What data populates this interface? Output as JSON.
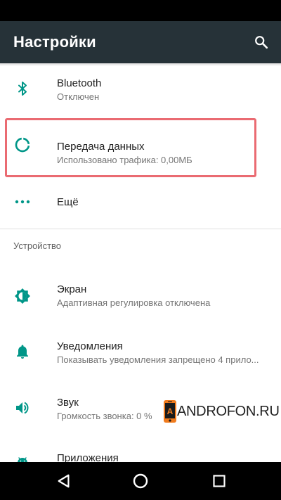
{
  "header": {
    "title": "Настройки"
  },
  "icons": {
    "search": "search-icon",
    "bluetooth": "bluetooth-icon",
    "data_usage": "data-usage-icon",
    "more": "more-horiz-icon",
    "display": "brightness-icon",
    "notifications": "bell-icon",
    "sound": "volume-icon",
    "apps": "android-icon"
  },
  "items": {
    "bluetooth": {
      "title": "Bluetooth",
      "subtitle": "Отключен"
    },
    "data_transfer": {
      "title": "Передача данных",
      "subtitle": "Использовано трафика: 0,00МБ"
    },
    "more": {
      "title": "Ещё"
    },
    "display": {
      "title": "Экран",
      "subtitle": "Адаптивная регулировка отключена"
    },
    "notifications": {
      "title": "Уведомления",
      "subtitle": "Показывать уведомления запрещено 4 прило..."
    },
    "sound": {
      "title": "Звук",
      "subtitle": "Громкость звонка: 0 %"
    },
    "apps": {
      "title": "Приложения"
    }
  },
  "sections": {
    "device": "Устройство"
  },
  "watermark": {
    "text": "ANDROFON.RU"
  },
  "colors": {
    "app_bar": "#263238",
    "accent": "#009688",
    "highlight": "#ea6b72"
  }
}
